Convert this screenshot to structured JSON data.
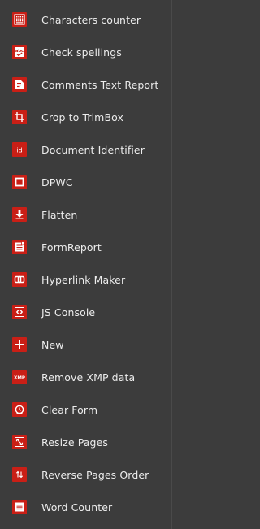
{
  "menu": {
    "items": [
      {
        "label": "Characters counter",
        "icon": "characters-counter-icon"
      },
      {
        "label": "Check spellings",
        "icon": "check-spellings-icon"
      },
      {
        "label": "Comments Text Report",
        "icon": "comments-report-icon"
      },
      {
        "label": "Crop to TrimBox",
        "icon": "crop-icon"
      },
      {
        "label": "Document Identifier",
        "icon": "document-identifier-icon"
      },
      {
        "label": "DPWC",
        "icon": "dpwc-icon"
      },
      {
        "label": "Flatten",
        "icon": "flatten-icon"
      },
      {
        "label": "FormReport",
        "icon": "form-report-icon"
      },
      {
        "label": "Hyperlink Maker",
        "icon": "hyperlink-icon"
      },
      {
        "label": "JS Console",
        "icon": "js-console-icon"
      },
      {
        "label": "New",
        "icon": "new-icon"
      },
      {
        "label": "Remove XMP data",
        "icon": "remove-xmp-icon"
      },
      {
        "label": "Clear Form",
        "icon": "clear-form-icon"
      },
      {
        "label": "Resize Pages",
        "icon": "resize-pages-icon"
      },
      {
        "label": "Reverse Pages Order",
        "icon": "reverse-pages-icon"
      },
      {
        "label": "Word Counter",
        "icon": "word-counter-icon"
      }
    ]
  },
  "icon_glyphs": {
    "check_spellings": "abc",
    "document_identifier": "id",
    "remove_xmp": "XMP"
  },
  "colors": {
    "background": "#3c3c3c",
    "icon_red": "#c91f16",
    "text": "#ececec"
  }
}
